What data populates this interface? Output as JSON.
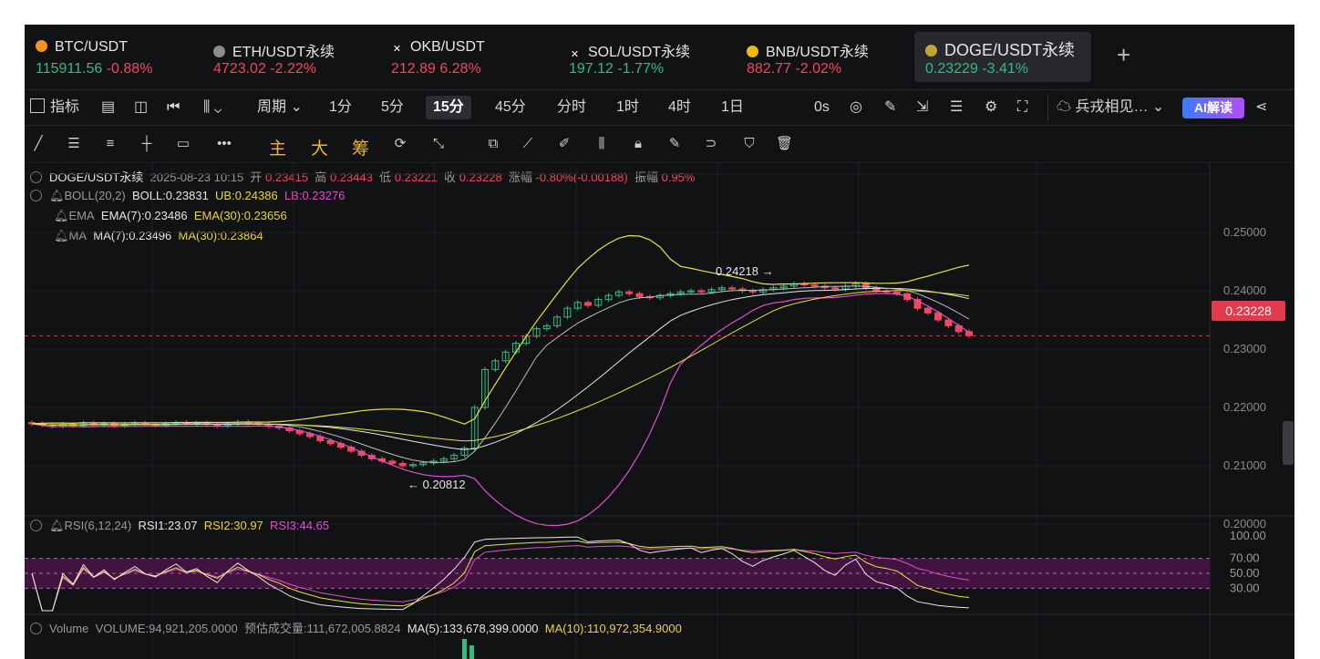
{
  "tickers": [
    {
      "symbol": "BTC/USDT",
      "price": "115911.56",
      "change": "-0.88%",
      "price_dir": "up",
      "chg_dir": "down",
      "coin_color": "#f7931a"
    },
    {
      "symbol": "ETH/USDT永续",
      "price": "4723.02",
      "change": "-2.22%",
      "price_dir": "down",
      "chg_dir": "down",
      "coin_color": "#8c8c8c"
    },
    {
      "symbol": "OKB/USDT",
      "price": "212.89",
      "change": "6.28%",
      "price_dir": "down",
      "chg_dir": "down",
      "coin_color": "#ffffff"
    },
    {
      "symbol": "SOL/USDT永续",
      "price": "197.12",
      "change": "-1.77%",
      "price_dir": "up",
      "chg_dir": "up",
      "coin_color": "#ffffff"
    },
    {
      "symbol": "BNB/USDT永续",
      "price": "882.77",
      "change": "-2.02%",
      "price_dir": "down",
      "chg_dir": "down",
      "coin_color": "#f0b90b"
    },
    {
      "symbol": "DOGE/USDT永续",
      "price": "0.23229",
      "change": "-3.41%",
      "price_dir": "up",
      "chg_dir": "up",
      "coin_color": "#c2a633"
    }
  ],
  "toolbar": {
    "indicator": "指标",
    "period": "周期",
    "intervals": [
      "1分",
      "5分",
      "15分",
      "45分",
      "分时",
      "1时",
      "4时",
      "1日"
    ],
    "selected_interval": "15分",
    "countdown": "0s",
    "strategy": "兵戎相见…",
    "ai": "AI解读"
  },
  "drawbar": {
    "main": "主",
    "big": "大",
    "chips": "筹"
  },
  "info": {
    "pair": "DOGE/USDT永续",
    "datetime": "2025-08-23 10:15",
    "open_label": "开",
    "open": "0.23415",
    "high_label": "高",
    "high": "0.23443",
    "low_label": "低",
    "low": "0.23221",
    "close_label": "收",
    "close": "0.23228",
    "chg_label": "涨幅",
    "chg": "-0.80%(-0.00188)",
    "amp_label": "振幅",
    "amp": "0.95%"
  },
  "boll": {
    "label": "BOLL(20,2)",
    "boll": "BOLL:0.23831",
    "ub": "UB:0.24386",
    "lb": "LB:0.23276"
  },
  "ema": {
    "label": "EMA",
    "ema7": "EMA(7):0.23486",
    "ema30": "EMA(30):0.23656"
  },
  "ma": {
    "label": "MA",
    "ma7": "MA(7):0.23496",
    "ma30": "MA(30):0.23864"
  },
  "rsi": {
    "label": "RSI(6,12,24)",
    "rsi1": "RSI1:23.07",
    "rsi2": "RSI2:30.97",
    "rsi3": "RSI3:44.65"
  },
  "volume": {
    "label": "Volume",
    "vol": "VOLUME:94,921,205.0000",
    "est": "预估成交量:111,672,005.8824",
    "ma5": "MA(5):133,678,399.0000",
    "ma10": "MA(10):110,972,354.9000"
  },
  "price_axis": [
    "0.25000",
    "0.24000",
    "0.23000",
    "0.22000",
    "0.21000",
    "0.20000"
  ],
  "rsi_axis": [
    "100.00",
    "70.00",
    "50.00",
    "30.00"
  ],
  "current_price_label": "0.23228",
  "annotations": {
    "high": "0.24218 →",
    "low": "← 0.20812"
  },
  "colors": {
    "up": "#2ebd85",
    "down": "#f6465d",
    "boll_band": "#e8e23a",
    "boll_lower": "#e04fd0",
    "accent": "#f0b90b"
  },
  "chart_data": {
    "type": "candlestick",
    "title": "DOGE/USDT永续",
    "interval": "15分",
    "ylim": [
      0.2,
      0.25
    ],
    "close": [
      0.2172,
      0.217,
      0.2168,
      0.2171,
      0.2169,
      0.2173,
      0.217,
      0.2172,
      0.2169,
      0.2171,
      0.2173,
      0.2171,
      0.217,
      0.2172,
      0.2174,
      0.2172,
      0.2173,
      0.2171,
      0.2169,
      0.2172,
      0.2175,
      0.2173,
      0.2171,
      0.2168,
      0.2165,
      0.216,
      0.2155,
      0.215,
      0.2143,
      0.2138,
      0.2132,
      0.2125,
      0.2118,
      0.2112,
      0.2108,
      0.2104,
      0.21,
      0.2102,
      0.2105,
      0.2108,
      0.2112,
      0.2118,
      0.213,
      0.22,
      0.2265,
      0.228,
      0.2295,
      0.231,
      0.2322,
      0.2335,
      0.234,
      0.2355,
      0.237,
      0.238,
      0.2375,
      0.2385,
      0.2392,
      0.2398,
      0.2395,
      0.239,
      0.2388,
      0.2392,
      0.2395,
      0.2398,
      0.24,
      0.2398,
      0.2402,
      0.2405,
      0.2403,
      0.24,
      0.2398,
      0.2402,
      0.2405,
      0.2408,
      0.2412,
      0.241,
      0.2408,
      0.2405,
      0.2403,
      0.2408,
      0.2412,
      0.2405,
      0.24,
      0.2398,
      0.2395,
      0.2385,
      0.237,
      0.2362,
      0.235,
      0.234,
      0.233,
      0.2323
    ],
    "rsi_levels": [
      70,
      50,
      30
    ]
  }
}
